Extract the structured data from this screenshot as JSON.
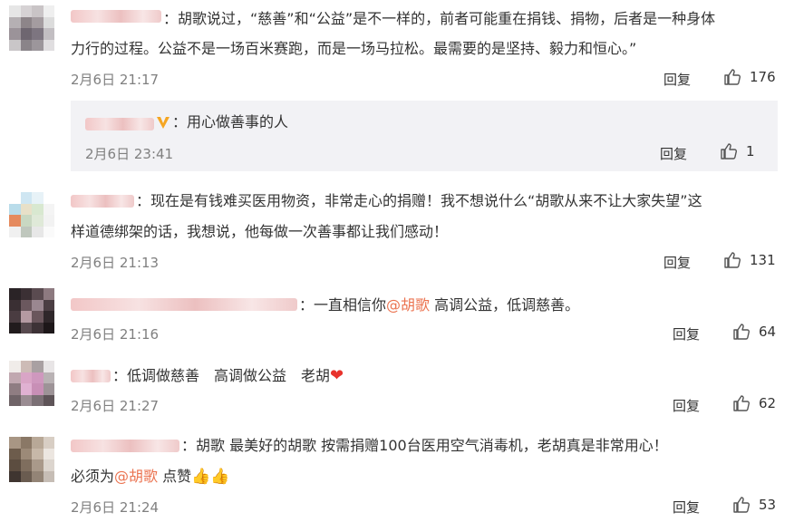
{
  "comments": [
    {
      "text": "：胡歌说过，“慈善”和“公益”是不一样的，前者可能重在捐钱、捐物，后者是一种身体力行的过程。公益不是一场百米赛跑，而是一场马拉松。最需要的是坚持、毅力和恒心。”",
      "line1": "：胡歌说过，“慈善”和“公益”是不一样的，前者可能重在捐钱、捐物，后者是一种身体",
      "line2": "力行的过程。公益不是一场百米赛跑，而是一场马拉松。最需要的是坚持、毅力和恒心。”",
      "time": "2月6日 21:17",
      "reply": "回复",
      "likes": "176",
      "sub": {
        "text": "：用心做善事的人",
        "time": "2月6日 23:41",
        "reply": "回复",
        "likes": "1"
      }
    },
    {
      "line1": "：现在是有钱难买医用物资，非常走心的捐赠！我不想说什么“胡歌从来不让大家失望”这",
      "line2": "样道德绑架的话，我想说，他每做一次善事都让我们感动！",
      "time": "2月6日 21:13",
      "reply": "回复",
      "likes": "131"
    },
    {
      "pre": "：一直相信你",
      "mention": "@胡歌",
      "post": " 高调公益，低调慈善。",
      "time": "2月6日 21:16",
      "reply": "回复",
      "likes": "64"
    },
    {
      "text": "：低调做慈善　高调做公益　老胡",
      "emoji": "❤",
      "time": "2月6日 21:27",
      "reply": "回复",
      "likes": "62"
    },
    {
      "line1": "：￼胡歌 ￼最美好的胡歌 按需捐赠100台医用空气消毒机，老胡真是非常用心！",
      "pre2": "必须为",
      "mention": "@胡歌",
      "post2": " 点赞",
      "emoji": "👍👍",
      "time": "2月6日 21:24",
      "reply": "回复",
      "likes": "53"
    }
  ],
  "colors": {
    "mention": "#eb7350",
    "meta": "#808080",
    "sub_bg": "#f2f2f5",
    "verified": "#f5a623"
  },
  "icons": [
    "thumbs-up-icon",
    "verified-badge-icon",
    "heart-emoji",
    "thumbs-up-emoji"
  ]
}
